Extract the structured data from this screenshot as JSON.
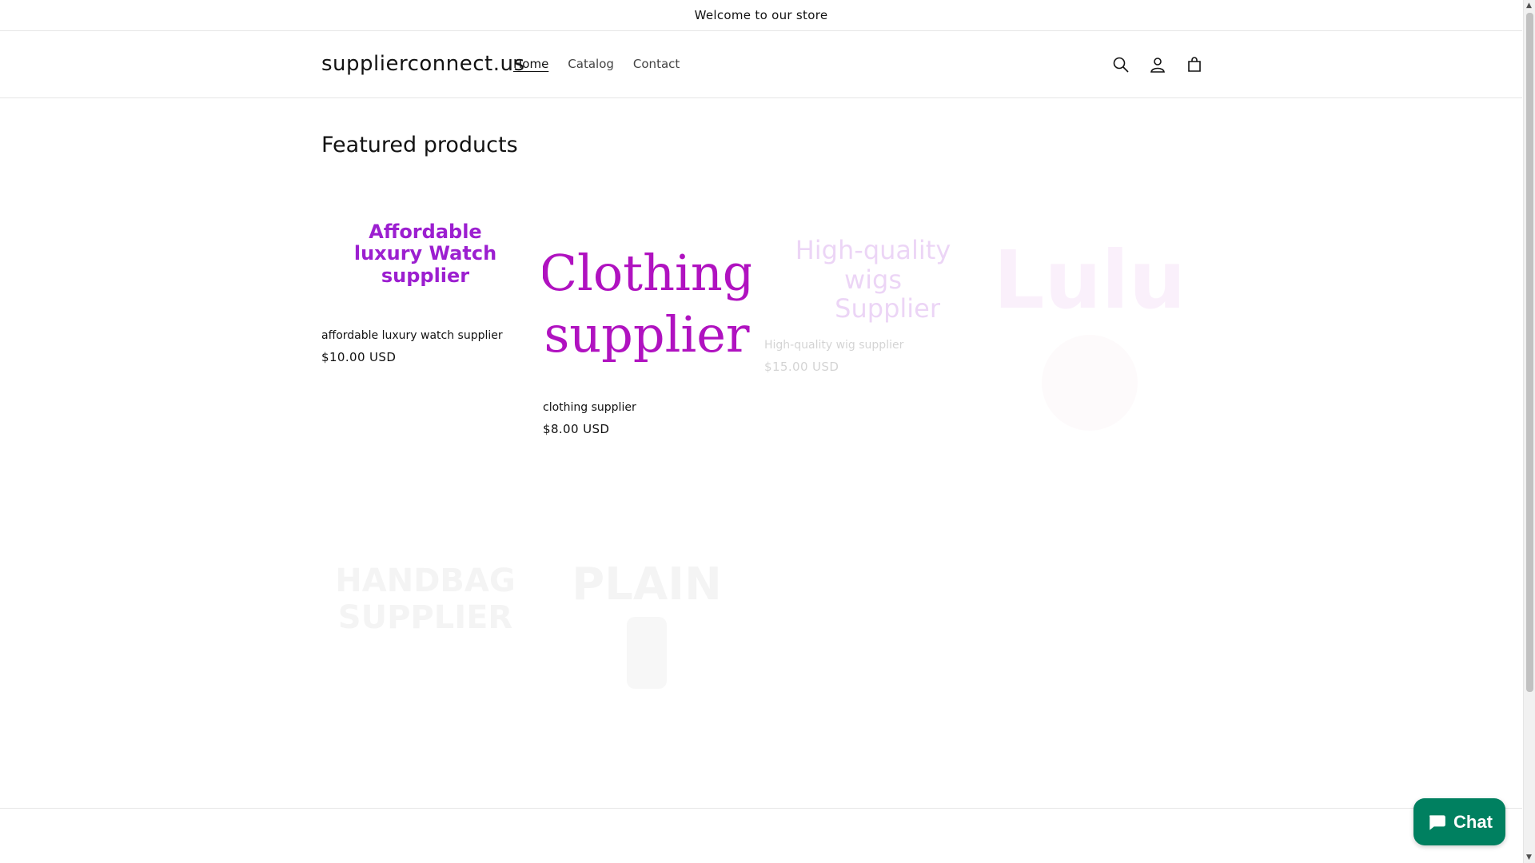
{
  "announcement": {
    "text": "Welcome to our store"
  },
  "header": {
    "logo": "supplierconnect.us",
    "nav": [
      {
        "label": "Home",
        "active": true
      },
      {
        "label": "Catalog",
        "active": false
      },
      {
        "label": "Contact",
        "active": false
      }
    ],
    "icons": [
      "search-icon",
      "account-icon",
      "cart-icon"
    ]
  },
  "main": {
    "section_title": "Featured products",
    "products": [
      {
        "image_text": "Affordable luxury Watch supplier",
        "title": "affordable luxury watch supplier",
        "price": "$10.00 USD"
      },
      {
        "image_text_line1": "Clothing",
        "image_text_line2": "supplier",
        "title": "clothing supplier",
        "price": "$8.00 USD"
      },
      {
        "image_text_line1": "High-quality wigs",
        "image_text_line2": "Supplier",
        "title": "High-quality wig supplier",
        "price": "$15.00 USD"
      },
      {
        "image_text": "Lulu"
      },
      {
        "image_text": "HANDBAG SUPPLIER"
      },
      {
        "image_text": "PLAIN"
      }
    ]
  },
  "chat": {
    "label": "Chat",
    "color": "#008060"
  },
  "colors": {
    "accent_purple": "#9c1fd0",
    "accent_magenta": "#b012c0",
    "border": "#e6e6e6"
  }
}
